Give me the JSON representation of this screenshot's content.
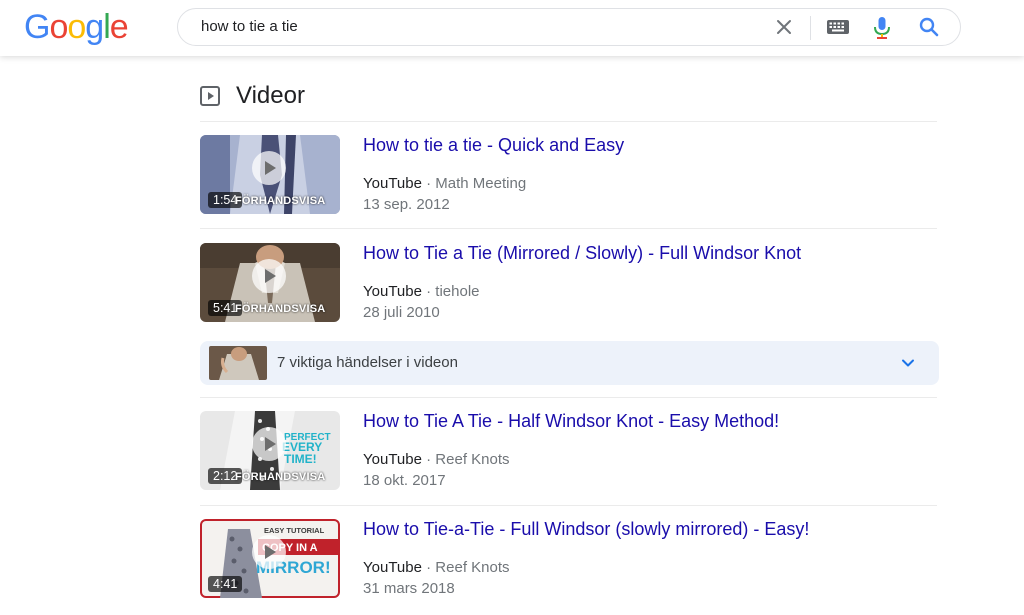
{
  "header": {
    "logo_letters": [
      {
        "char": "G",
        "color": "#4285F4"
      },
      {
        "char": "o",
        "color": "#EA4335"
      },
      {
        "char": "o",
        "color": "#FBBC05"
      },
      {
        "char": "g",
        "color": "#4285F4"
      },
      {
        "char": "l",
        "color": "#34A853"
      },
      {
        "char": "e",
        "color": "#EA4335"
      }
    ],
    "search_query": "how to tie a tie",
    "icons": [
      "close-icon",
      "keyboard-icon",
      "microphone-icon",
      "search-icon"
    ]
  },
  "section": {
    "title": "Videor",
    "icon": "video-play-icon"
  },
  "results": [
    {
      "title": "How to tie a tie - Quick and Easy",
      "source": "YouTube",
      "separator": "·",
      "channel": "Math Meeting",
      "date": "13 sep. 2012",
      "duration": "1:54",
      "preview_label": "FÖRHANDSVISA"
    },
    {
      "title": "How to Tie a Tie (Mirrored / Slowly) - Full Windsor Knot",
      "source": "YouTube",
      "separator": "·",
      "channel": "tiehole",
      "date": "28 juli 2010",
      "duration": "5:41",
      "preview_label": "FÖRHANDSVISA"
    },
    {
      "title": "How to Tie A Tie - Half Windsor Knot - Easy Method!",
      "source": "YouTube",
      "separator": "·",
      "channel": "Reef Knots",
      "date": "18 okt. 2017",
      "duration": "2:12",
      "preview_label": "FÖRHANDSVISA",
      "thumb_text": [
        "PERFECT",
        "EVERY",
        "TIME!"
      ]
    },
    {
      "title": "How to Tie-a-Tie - Full Windsor (slowly mirrored) - Easy!",
      "source": "YouTube",
      "separator": "·",
      "channel": "Reef Knots",
      "date": "31 mars 2018",
      "duration": "4:41",
      "thumb_text": [
        "EASY TUTORIAL",
        "COPY IN A",
        "MIRROR!"
      ]
    }
  ],
  "key_moments": {
    "label": "7 viktiga händelser i videon",
    "icon": "chevron-down-icon"
  },
  "colors": {
    "link": "#1a0dab",
    "meta": "#70757a",
    "moments_bg": "#edf2fa",
    "accent_blue": "#1a73e8"
  }
}
